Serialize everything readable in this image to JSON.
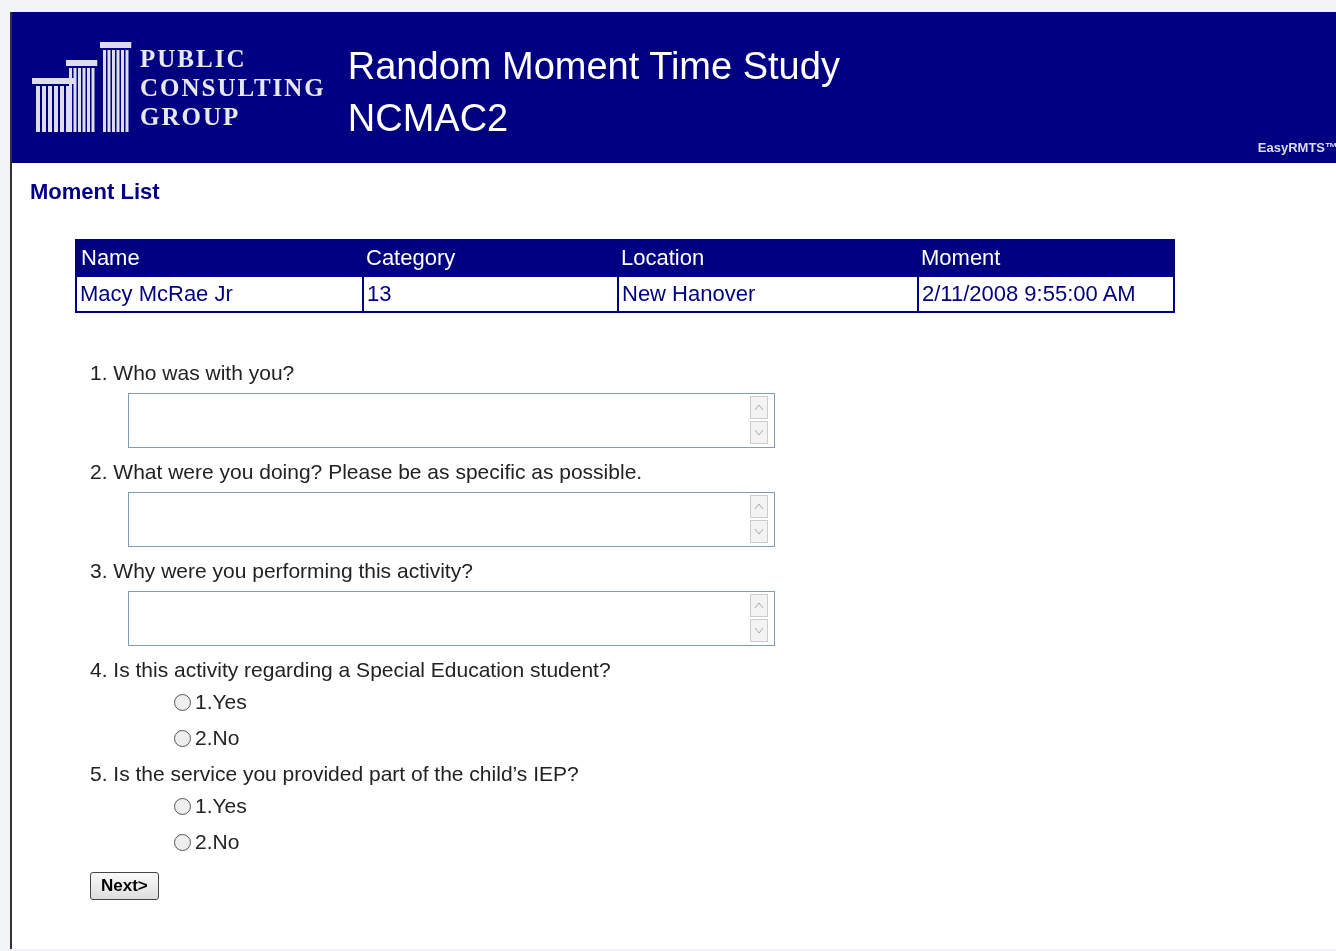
{
  "header": {
    "logo_lines": [
      "PUBLIC",
      "CONSULTING",
      "GROUP"
    ],
    "title": "Random Moment Time Study",
    "subtitle": "NCMAC2",
    "brand": "EasyRMTS™"
  },
  "section_title": "Moment List",
  "table": {
    "columns": [
      "Name",
      "Category",
      "Location",
      "Moment"
    ],
    "rows": [
      [
        "Macy McRae Jr",
        "13",
        "New Hanover",
        "2/11/2008 9:55:00 AM"
      ]
    ]
  },
  "questions": [
    {
      "kind": "text",
      "label": "1. Who was with you?"
    },
    {
      "kind": "text",
      "label": "2. What were you doing? Please be as specific as possible."
    },
    {
      "kind": "text",
      "label": "3. Why were you performing this activity?"
    },
    {
      "kind": "radio",
      "label": "4. Is this activity regarding a Special Education student?",
      "options": [
        {
          "label": "1.Yes",
          "selected": false
        },
        {
          "label": "2.No",
          "selected": false
        }
      ]
    },
    {
      "kind": "radio",
      "label": "5. Is the service you provided part of the child’s IEP?",
      "options": [
        {
          "label": "1.Yes",
          "selected": false
        },
        {
          "label": "2.No",
          "selected": false
        }
      ]
    }
  ],
  "next_button": "Next>"
}
